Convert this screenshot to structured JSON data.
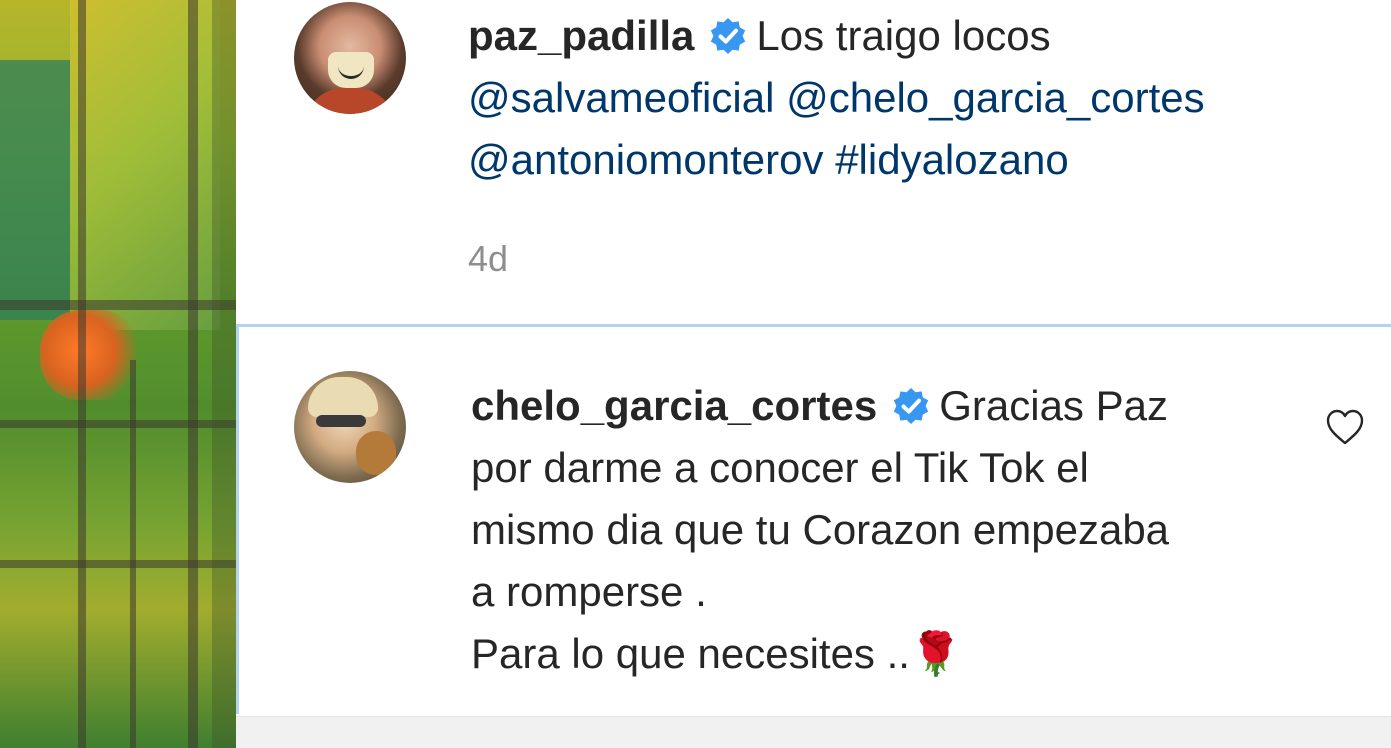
{
  "caption": {
    "username": "paz_padilla",
    "text": "Los traigo locos",
    "mentions": [
      "@salvameoficial",
      "@chelo_garcia_cortes",
      "@antoniomonterov",
      "#lidyalozano"
    ],
    "time": "4d"
  },
  "reply": {
    "username": "chelo_garcia_cortes",
    "lines": [
      "Gracias Paz",
      "por darme a conocer el Tik Tok el",
      "mismo dia que tu Corazon empezaba",
      "a romperse .",
      "Para lo que necesites ..🌹"
    ]
  },
  "colors": {
    "verified_badge": "#3897f0",
    "link": "#00376b",
    "text": "#262626",
    "meta": "#8e8e8e",
    "highlight_border": "#b3d4f0"
  },
  "icons": {
    "verified": "verified-badge-icon",
    "like": "heart-outline-icon"
  }
}
